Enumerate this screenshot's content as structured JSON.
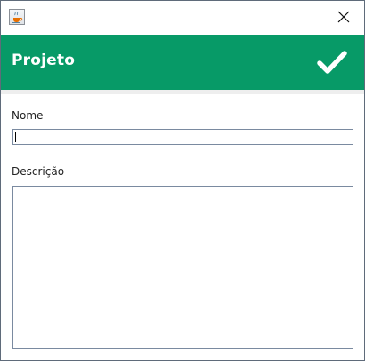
{
  "window": {
    "app_icon": "java-coffee-icon",
    "close_icon": "close-icon"
  },
  "header": {
    "title": "Projeto",
    "confirm_icon": "checkmark-icon",
    "background_color": "#079a67"
  },
  "form": {
    "name_label": "Nome",
    "name_value": "",
    "description_label": "Descrição",
    "description_value": ""
  }
}
